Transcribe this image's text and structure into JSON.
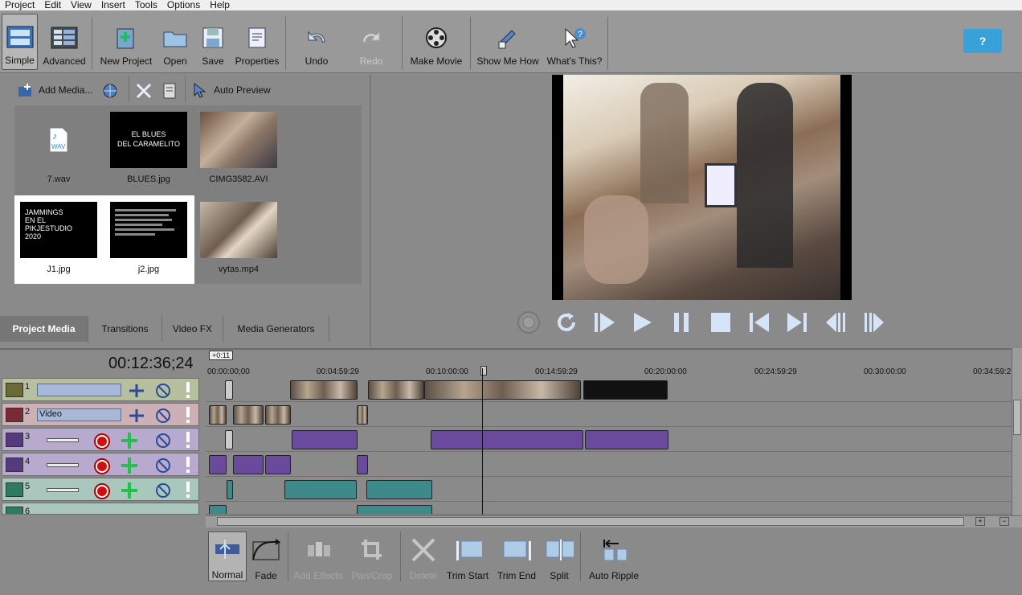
{
  "menu": [
    "Project",
    "Edit",
    "View",
    "Insert",
    "Tools",
    "Options",
    "Help"
  ],
  "toolbar": {
    "items": [
      {
        "label": "Simple",
        "icon": "simple-mode-icon"
      },
      {
        "label": "Advanced",
        "icon": "advanced-mode-icon"
      },
      {
        "label": "New Project",
        "icon": "new-project-icon"
      },
      {
        "label": "Open",
        "icon": "folder-icon"
      },
      {
        "label": "Save",
        "icon": "floppy-icon"
      },
      {
        "label": "Properties",
        "icon": "properties-icon"
      },
      {
        "label": "Undo",
        "icon": "undo-icon"
      },
      {
        "label": "Redo",
        "icon": "redo-icon"
      },
      {
        "label": "Make Movie",
        "icon": "film-reel-icon"
      },
      {
        "label": "Show Me How",
        "icon": "pointing-hand-icon"
      },
      {
        "label": "What's This?",
        "icon": "question-cursor-icon"
      }
    ],
    "help": "?"
  },
  "media": {
    "add_label": "Add Media...",
    "auto_preview": "Auto Preview",
    "items": [
      {
        "name": "7.wav",
        "kind": "audio"
      },
      {
        "name": "BLUES.jpg",
        "kind": "title",
        "text": "EL BLUES\nDEL CARAMELITO"
      },
      {
        "name": "CIMG3582.AVI",
        "kind": "photo"
      },
      {
        "name": "J1.jpg",
        "kind": "title",
        "text": "JAMMINGS\nEN EL\nPIKJESTUDIO\n2020"
      },
      {
        "name": "j2.jpg",
        "kind": "text"
      },
      {
        "name": "vytas.mp4",
        "kind": "photo"
      }
    ]
  },
  "tabs": [
    "Project Media",
    "Transitions",
    "Video FX",
    "Media Generators"
  ],
  "timeline": {
    "timecode": "00:12:36;24",
    "zoom_badge": "+0:11",
    "ruler": [
      "00:00:00;00",
      "00:04:59:29",
      "00:10:00:00",
      "00:14:59:29",
      "00:20:00:00",
      "00:24:59:29",
      "00:30:00:00",
      "00:34:59:2"
    ],
    "tracks": [
      {
        "num": "1",
        "type": "video",
        "name": ""
      },
      {
        "num": "2",
        "type": "video",
        "name": "Video"
      },
      {
        "num": "3",
        "type": "audio"
      },
      {
        "num": "4",
        "type": "audio"
      },
      {
        "num": "5",
        "type": "audio"
      },
      {
        "num": "6",
        "type": "audio"
      }
    ]
  },
  "edit_tools": [
    {
      "label": "Normal",
      "enabled": true,
      "selected": true
    },
    {
      "label": "Fade",
      "enabled": true
    },
    {
      "label": "Add Effects",
      "enabled": false
    },
    {
      "label": "Pan/Crop",
      "enabled": false
    },
    {
      "label": "Delete",
      "enabled": false
    },
    {
      "label": "Trim Start",
      "enabled": true
    },
    {
      "label": "Trim End",
      "enabled": true
    },
    {
      "label": "Split",
      "enabled": true
    },
    {
      "label": "Auto Ripple",
      "enabled": true
    }
  ],
  "colors": {
    "accent": "#3aa0d8",
    "audio_clip": "#6a4a9a",
    "audio_clip_teal": "#3e8a8a",
    "record": "#d01010"
  }
}
